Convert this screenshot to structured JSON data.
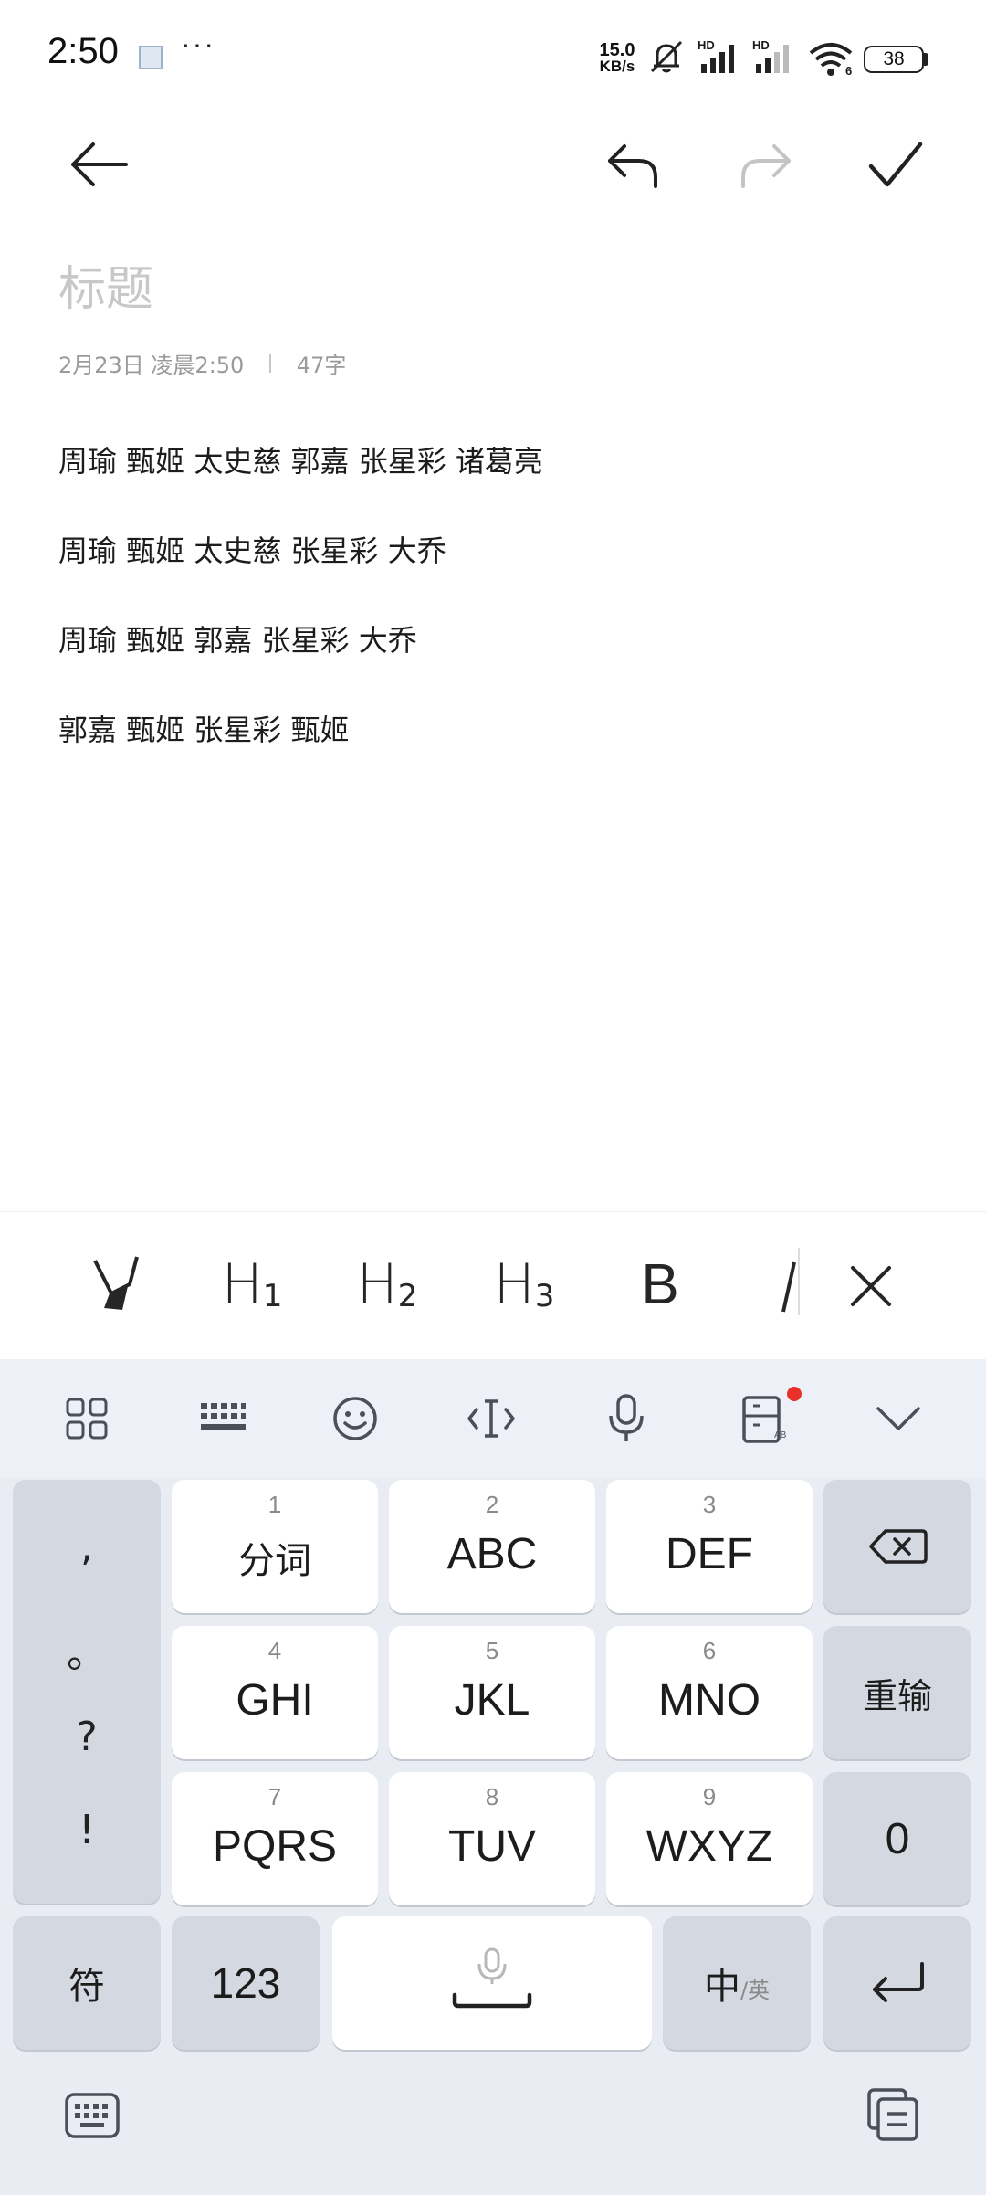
{
  "status_bar": {
    "time": "2:50",
    "more": "···",
    "net_speed_value": "15.0",
    "net_speed_unit": "KB/s",
    "network_1": "HD",
    "network_2": "HD",
    "wifi_badge": "6",
    "battery": "38"
  },
  "note": {
    "title_placeholder": "标题",
    "date": "2月23日 凌晨2:50",
    "word_count": "47字",
    "lines": [
      "周瑜 甄姬 太史慈 郭嘉 张星彩 诸葛亮",
      "周瑜 甄姬 太史慈 张星彩 大乔",
      "周瑜 甄姬 郭嘉 张星彩 大乔",
      "郭嘉 甄姬 张星彩 甄姬"
    ]
  },
  "format_toolbar": {
    "h1": {
      "main": "H",
      "sub": "1"
    },
    "h2": {
      "main": "H",
      "sub": "2"
    },
    "h3": {
      "main": "H",
      "sub": "3"
    },
    "bold": "B"
  },
  "keyboard": {
    "punctuation": [
      ",",
      "。",
      "?",
      "!"
    ],
    "keys": [
      {
        "num": "1",
        "label": "分词"
      },
      {
        "num": "2",
        "label": "ABC"
      },
      {
        "num": "3",
        "label": "DEF"
      },
      {
        "num": "4",
        "label": "GHI"
      },
      {
        "num": "5",
        "label": "JKL"
      },
      {
        "num": "6",
        "label": "MNO"
      },
      {
        "num": "7",
        "label": "PQRS"
      },
      {
        "num": "8",
        "label": "TUV"
      },
      {
        "num": "9",
        "label": "WXYZ"
      }
    ],
    "retype": "重输",
    "zero": "0",
    "symbols": "符",
    "numbers": "123",
    "lang_main": "中",
    "lang_sub": "/英",
    "dict_badge": "AB"
  }
}
